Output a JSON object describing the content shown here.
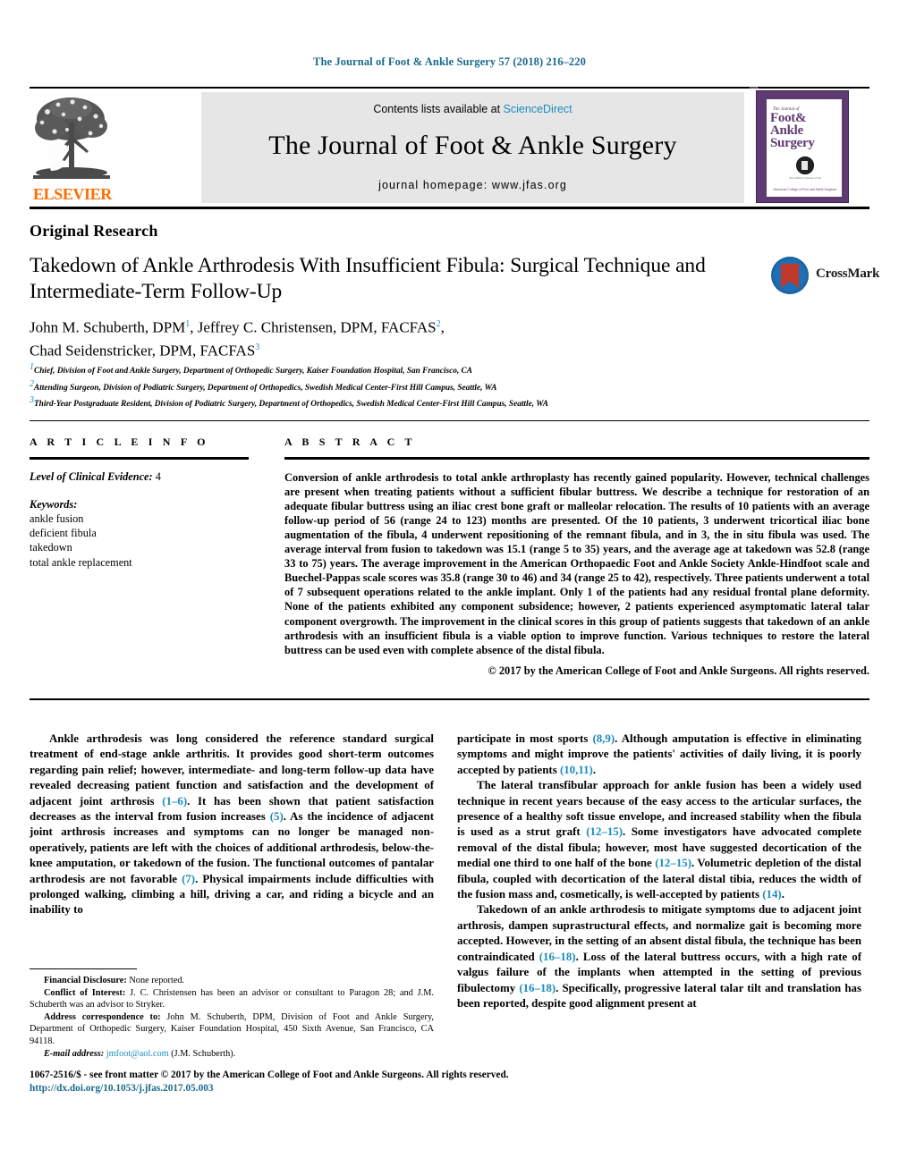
{
  "running_head": "The Journal of Foot & Ankle Surgery 57 (2018) 216–220",
  "masthead": {
    "publisher_logo_label": "ELSEVIER",
    "contents_prefix": "Contents lists available at ",
    "contents_link": "ScienceDirect",
    "journal_name": "The Journal of Foot & Ankle Surgery",
    "homepage": "journal homepage: www.jfas.org",
    "cover": {
      "issn_tiny": "ISSN",
      "the_journal_of": "The Journal of",
      "title_line1": "Foot&",
      "title_line2": "Ankle",
      "title_line3": "Surgery",
      "society_small": "The Official Journal of the",
      "society_line": "American College of Foot and Ankle Surgeons"
    }
  },
  "article": {
    "section_type": "Original Research",
    "title": "Takedown of Ankle Arthrodesis With Insufficient Fibula: Surgical Technique and Intermediate-Term Follow-Up",
    "authors_line1_a": "John M. Schuberth, DPM",
    "authors_sup1": "1",
    "authors_line1_b": ", Jeffrey C. Christensen, DPM, FACFAS",
    "authors_sup2": "2",
    "authors_line1_c": ",",
    "authors_line2_a": "Chad Seidenstricker, DPM, FACFAS",
    "authors_sup3": "3",
    "affiliations": [
      {
        "marker": "1",
        "text": "Chief, Division of Foot and Ankle Surgery, Department of Orthopedic Surgery, Kaiser Foundation Hospital, San Francisco, CA"
      },
      {
        "marker": "2",
        "text": "Attending Surgeon, Division of Podiatric Surgery, Department of Orthopedics, Swedish Medical Center-First Hill Campus, Seattle, WA"
      },
      {
        "marker": "3",
        "text": "Third-Year Postgraduate Resident, Division of Podiatric Surgery, Department of Orthopedics, Swedish Medical Center-First Hill Campus, Seattle, WA"
      }
    ],
    "crossmark_label": "CrossMark"
  },
  "article_info": {
    "heading": "A R T I C L E  I N F O",
    "evidence_label": "Level of Clinical Evidence:",
    "evidence_value": "4",
    "keywords_label": "Keywords:",
    "keywords": [
      "ankle fusion",
      "deficient fibula",
      "takedown",
      "total ankle replacement"
    ]
  },
  "abstract": {
    "heading": "A B S T R A C T",
    "text": "Conversion of ankle arthrodesis to total ankle arthroplasty has recently gained popularity. However, technical challenges are present when treating patients without a sufficient fibular buttress. We describe a technique for restoration of an adequate fibular buttress using an iliac crest bone graft or malleolar relocation. The results of 10 patients with an average follow-up period of 56 (range 24 to 123) months are presented. Of the 10 patients, 3 underwent tricortical iliac bone augmentation of the fibula, 4 underwent repositioning of the remnant fibula, and in 3, the in situ fibula was used. The average interval from fusion to takedown was 15.1 (range 5 to 35) years, and the average age at takedown was 52.8 (range 33 to 75) years. The average improvement in the American Orthopaedic Foot and Ankle Society Ankle-Hindfoot scale and Buechel-Pappas scale scores was 35.8 (range 30 to 46) and 34 (range 25 to 42), respectively. Three patients underwent a total of 7 subsequent operations related to the ankle implant. Only 1 of the patients had any residual frontal plane deformity. None of the patients exhibited any component subsidence; however, 2 patients experienced asymptomatic lateral talar component overgrowth. The improvement in the clinical scores in this group of patients suggests that takedown of an ankle arthrodesis with an insufficient fibula is a viable option to improve function. Various techniques to restore the lateral buttress can be used even with complete absence of the distal fibula.",
    "copyright": "© 2017 by the American College of Foot and Ankle Surgeons. All rights reserved."
  },
  "body": {
    "left": [
      {
        "indent": true,
        "segments": [
          {
            "t": "Ankle arthrodesis was long considered the reference standard surgical treatment of end-stage ankle arthritis. It provides good short-term outcomes regarding pain relief; however, intermediate- and long-term follow-up data have revealed decreasing patient function and satisfaction and the development of adjacent joint arthrosis "
          },
          {
            "t": "(1–6)",
            "cite": true
          },
          {
            "t": ". It has been shown that patient satisfaction decreases as the interval from fusion increases "
          },
          {
            "t": "(5)",
            "cite": true
          },
          {
            "t": ". As the incidence of adjacent joint arthrosis increases and symptoms can no longer be managed non-operatively, patients are left with the choices of additional arthrodesis, below-the-knee amputation, or takedown of the fusion. The functional outcomes of pantalar arthrodesis are not favorable "
          },
          {
            "t": "(7)",
            "cite": true
          },
          {
            "t": ". Physical impairments include difficulties with prolonged walking, climbing a hill, driving a car, and riding a bicycle and an inability to"
          }
        ]
      }
    ],
    "right": [
      {
        "indent": false,
        "segments": [
          {
            "t": "participate in most sports "
          },
          {
            "t": "(8,9)",
            "cite": true
          },
          {
            "t": ". Although amputation is effective in eliminating symptoms and might improve the patients' activities of daily living, it is poorly accepted by patients "
          },
          {
            "t": "(10,11)",
            "cite": true
          },
          {
            "t": "."
          }
        ]
      },
      {
        "indent": true,
        "segments": [
          {
            "t": "The lateral transfibular approach for ankle fusion has been a widely used technique in recent years because of the easy access to the articular surfaces, the presence of a healthy soft tissue envelope, and increased stability when the fibula is used as a strut graft "
          },
          {
            "t": "(12–15)",
            "cite": true
          },
          {
            "t": ". Some investigators have advocated complete removal of the distal fibula; however, most have suggested decortication of the medial one third to one half of the bone "
          },
          {
            "t": "(12–15)",
            "cite": true
          },
          {
            "t": ". Volumetric depletion of the distal fibula, coupled with decortication of the lateral distal tibia, reduces the width of the fusion mass and, cosmetically, is well-accepted by patients "
          },
          {
            "t": "(14)",
            "cite": true
          },
          {
            "t": "."
          }
        ]
      },
      {
        "indent": true,
        "segments": [
          {
            "t": "Takedown of an ankle arthrodesis to mitigate symptoms due to adjacent joint arthrosis, dampen suprastructural effects, and normalize gait is becoming more accepted. However, in the setting of an absent distal fibula, the technique has been contraindicated "
          },
          {
            "t": "(16–18)",
            "cite": true
          },
          {
            "t": ". Loss of the lateral buttress occurs, with a high rate of valgus failure of the implants when attempted in the setting of previous fibulectomy "
          },
          {
            "t": "(16–18)",
            "cite": true
          },
          {
            "t": ". Specifically, progressive lateral talar tilt and translation has been reported, despite good alignment present at"
          }
        ]
      }
    ]
  },
  "footnotes": {
    "financial_label": "Financial Disclosure:",
    "financial_text": " None reported.",
    "conflict_label": "Conflict of Interest:",
    "conflict_text": " J. C. Christensen has been an advisor or consultant to Paragon 28; and J.M. Schuberth was an advisor to Stryker.",
    "address_label": "Address correspondence to:",
    "address_text": " John M. Schuberth, DPM, Division of Foot and Ankle Surgery, Department of Orthopedic Surgery, Kaiser Foundation Hospital, 450 Sixth Avenue, San Francisco, CA 94118.",
    "email_label": "E-mail address:",
    "email_value": "jmfoot@aol.com",
    "email_suffix": " (J.M. Schuberth)."
  },
  "footer": {
    "issn_line": "1067-2516/$ - see front matter © 2017 by the American College of Foot and Ankle Surgeons. All rights reserved.",
    "doi_line": "http://dx.doi.org/10.1053/j.jfas.2017.05.003"
  },
  "colors": {
    "link_blue": "#1b8bbd",
    "head_blue": "#1b6a8c",
    "elsevier_orange": "#ff6c00",
    "cover_purple": "#5f3a72",
    "crossmark_blue": "#1f6fb5",
    "crossmark_red": "#c0392b"
  }
}
